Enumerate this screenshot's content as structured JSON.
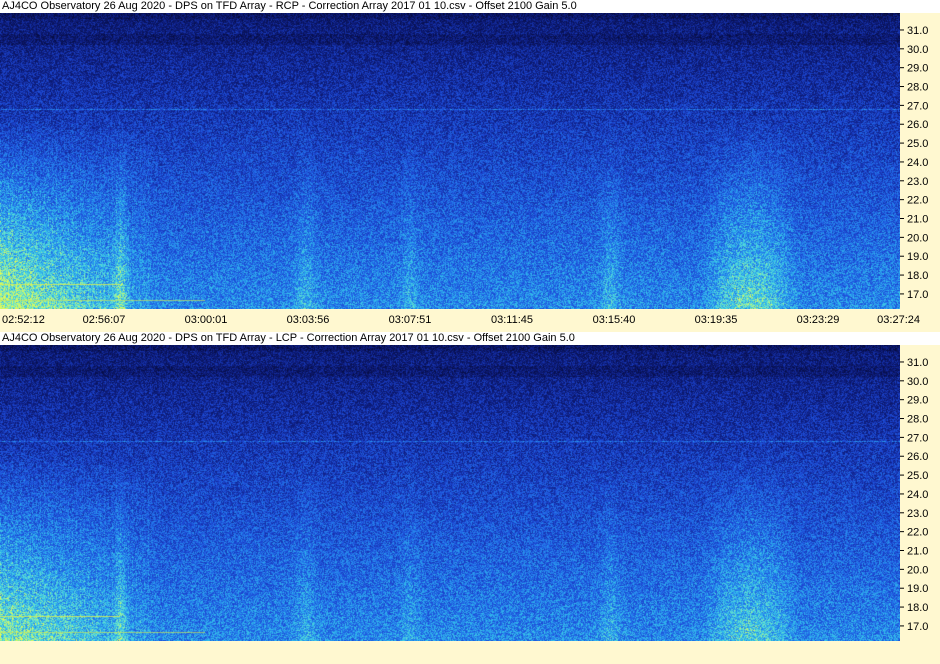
{
  "chart_data": [
    {
      "type": "heatmap",
      "title": "AJ4CO Observatory 26 Aug 2020  -  DPS on TFD Array  -  RCP  -  Correction Array 2017 01 10.csv  -  Offset 2100  Gain 5.0",
      "polarization": "RCP",
      "y_ticks": [
        "31.0",
        "30.0",
        "29.0",
        "28.0",
        "27.0",
        "26.0",
        "25.0",
        "24.0",
        "23.0",
        "22.0",
        "21.0",
        "20.0",
        "19.0",
        "18.0",
        "17.0"
      ],
      "ylim": [
        16.2,
        31.9
      ],
      "x_ticks": [
        "02:52:12",
        "02:56:07",
        "03:00:01",
        "03:03:56",
        "03:07:51",
        "03:11:45",
        "03:15:40",
        "03:19:35",
        "03:23:29",
        "03:27:24"
      ],
      "xlim": [
        "02:52:12",
        "03:27:24"
      ]
    },
    {
      "type": "heatmap",
      "title": "AJ4CO Observatory 26 Aug 2020  -  DPS on TFD Array  -  LCP  -  Correction Array 2017 01 10.csv  -  Offset 2100  Gain 5.0",
      "polarization": "LCP",
      "y_ticks": [
        "31.0",
        "30.0",
        "29.0",
        "28.0",
        "27.0",
        "26.0",
        "25.0",
        "24.0",
        "23.0",
        "22.0",
        "21.0",
        "20.0",
        "19.0",
        "18.0",
        "17.0"
      ],
      "ylim": [
        16.2,
        31.9
      ],
      "x_ticks": [],
      "xlim": [
        "02:52:12",
        "03:27:24"
      ]
    }
  ],
  "colors": {
    "background": "#fff8d0",
    "low_intensity": "#0a1e78",
    "mid_intensity": "#1f55d8",
    "high_intensity": "#3ad2e6",
    "burst": "#c8f060"
  }
}
